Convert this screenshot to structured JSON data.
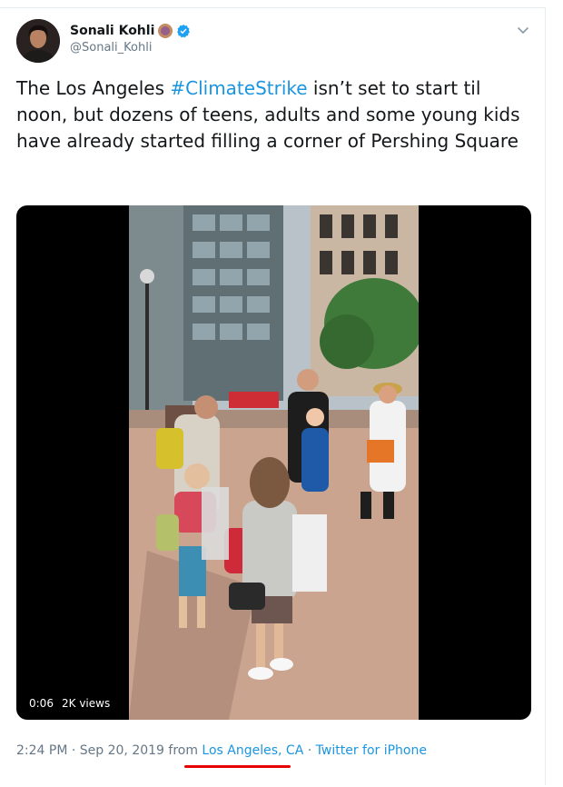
{
  "author": {
    "display_name": "Sonali Kohli",
    "handle": "@Sonali_Kohli",
    "verified": true
  },
  "tweet": {
    "text_before": "The Los Angeles ",
    "hashtag": "#ClimateStrike",
    "text_after": " isn’t set to start til noon, but dozens of teens, adults and some young kids have already started filling a corner of Pershing Square"
  },
  "video": {
    "duration": "0:06",
    "views": "2K views"
  },
  "meta": {
    "time_date": "2:24 PM · Sep 20, 2019 from ",
    "location": "Los Angeles, CA",
    "separator": " · ",
    "source": "Twitter for iPhone"
  },
  "colors": {
    "link": "#1b95e0",
    "secondary_text": "#657786",
    "annotation_underline": "#e60000"
  },
  "icons": [
    "verified-badge-icon",
    "chevron-down-icon",
    "emoji-icon"
  ]
}
